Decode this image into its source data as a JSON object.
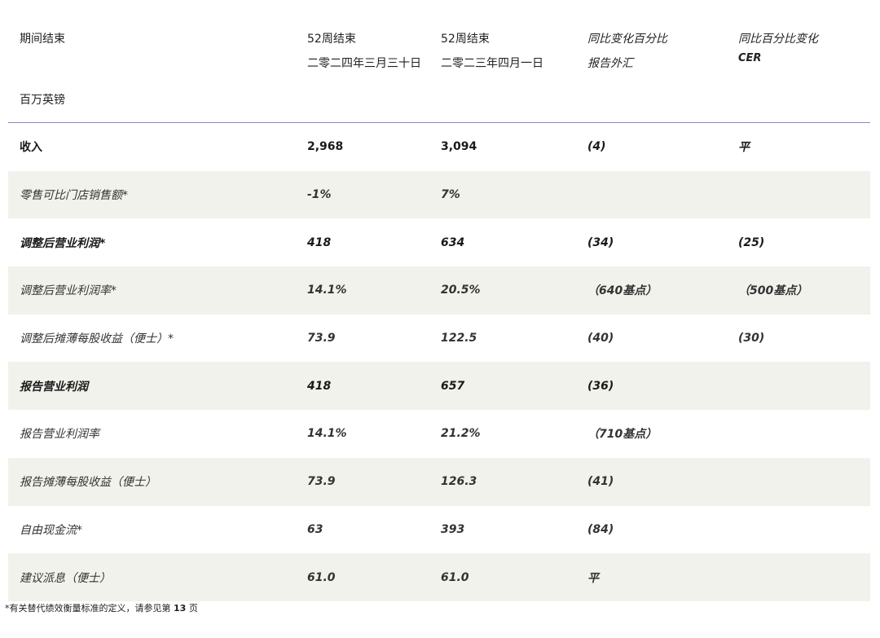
{
  "header": {
    "col0": "期间结束",
    "unit": "百万英镑",
    "col1_line1": "52周结束",
    "col1_line2": "二零二四年三月三十日",
    "col2_line1": "52周结束",
    "col2_line2": "二零二三年四月一日",
    "col3_line1": "同比变化百分比",
    "col3_line2": "报告外汇",
    "col4_line1": "同比百分比变化",
    "col4_line2": "CER"
  },
  "rows": [
    {
      "label": "收入",
      "v2024": "2,968",
      "v2023": "3,094",
      "reported": "(4)",
      "cer": "平"
    },
    {
      "label": "零售可比门店销售额*",
      "v2024": "-1%",
      "v2023": "7%",
      "reported": "",
      "cer": ""
    },
    {
      "label": "调整后营业利润*",
      "v2024": "418",
      "v2023": "634",
      "reported": "(34)",
      "cer": "(25)"
    },
    {
      "label": "调整后营业利润率*",
      "v2024": "14.1%",
      "v2023": "20.5%",
      "reported": "（640基点）",
      "cer": "（500基点）"
    },
    {
      "label": "调整后摊薄每股收益（便士）*",
      "v2024": "73.9",
      "v2023": "122.5",
      "reported": "(40)",
      "cer": "(30)"
    },
    {
      "label": "报告营业利润",
      "v2024": "418",
      "v2023": "657",
      "reported": "(36)",
      "cer": ""
    },
    {
      "label": "报告营业利润率",
      "v2024": "14.1%",
      "v2023": "21.2%",
      "reported": "（710基点）",
      "cer": ""
    },
    {
      "label": "报告摊薄每股收益（便士）",
      "v2024": "73.9",
      "v2023": "126.3",
      "reported": "(41)",
      "cer": ""
    },
    {
      "label": "自由现金流*",
      "v2024": "63",
      "v2023": "393",
      "reported": "(84)",
      "cer": ""
    },
    {
      "label": "建议派息（便士）",
      "v2024": "61.0",
      "v2023": "61.0",
      "reported": "平",
      "cer": ""
    }
  ],
  "footnote": {
    "text": "*有关替代绩效衡量标准的定义，请参见第",
    "page": "13",
    "suffix": "页"
  }
}
